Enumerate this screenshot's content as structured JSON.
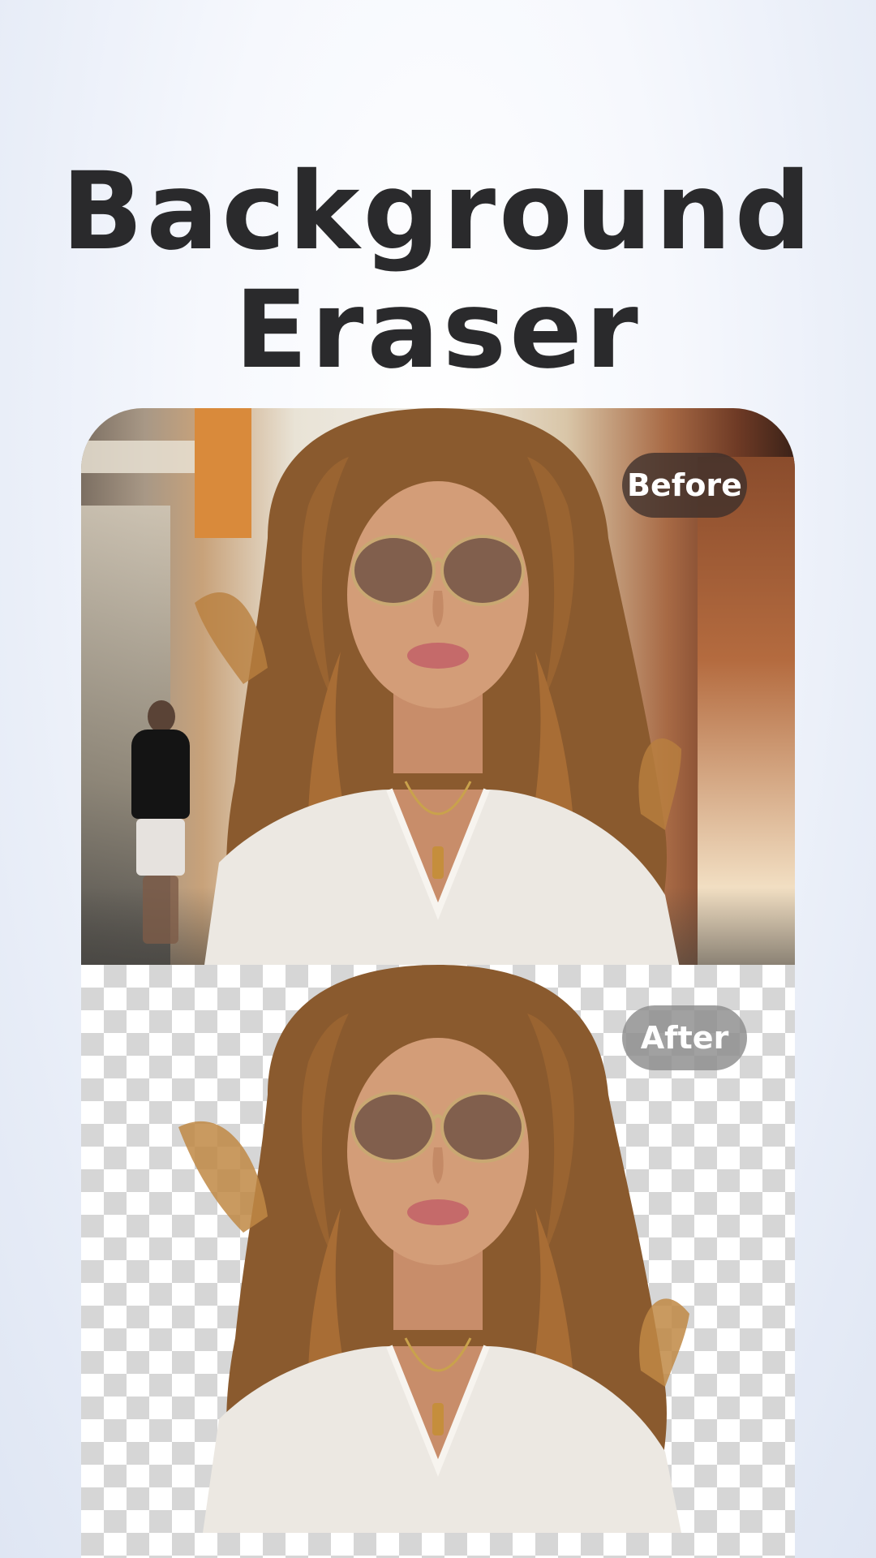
{
  "headline": {
    "line1": "Background",
    "line2": "Eraser"
  },
  "comparison": {
    "before_label": "Before",
    "after_label": "After"
  },
  "colors": {
    "headline_text": "#2a2a2c",
    "before_pill": "#3c302c",
    "after_pill": "#8c8c8c",
    "checker_dark": "#d6d6d6",
    "checker_light": "#ffffff"
  },
  "icons": {
    "subject_photo": "woman-portrait-icon",
    "transparency": "checkerboard-pattern"
  }
}
